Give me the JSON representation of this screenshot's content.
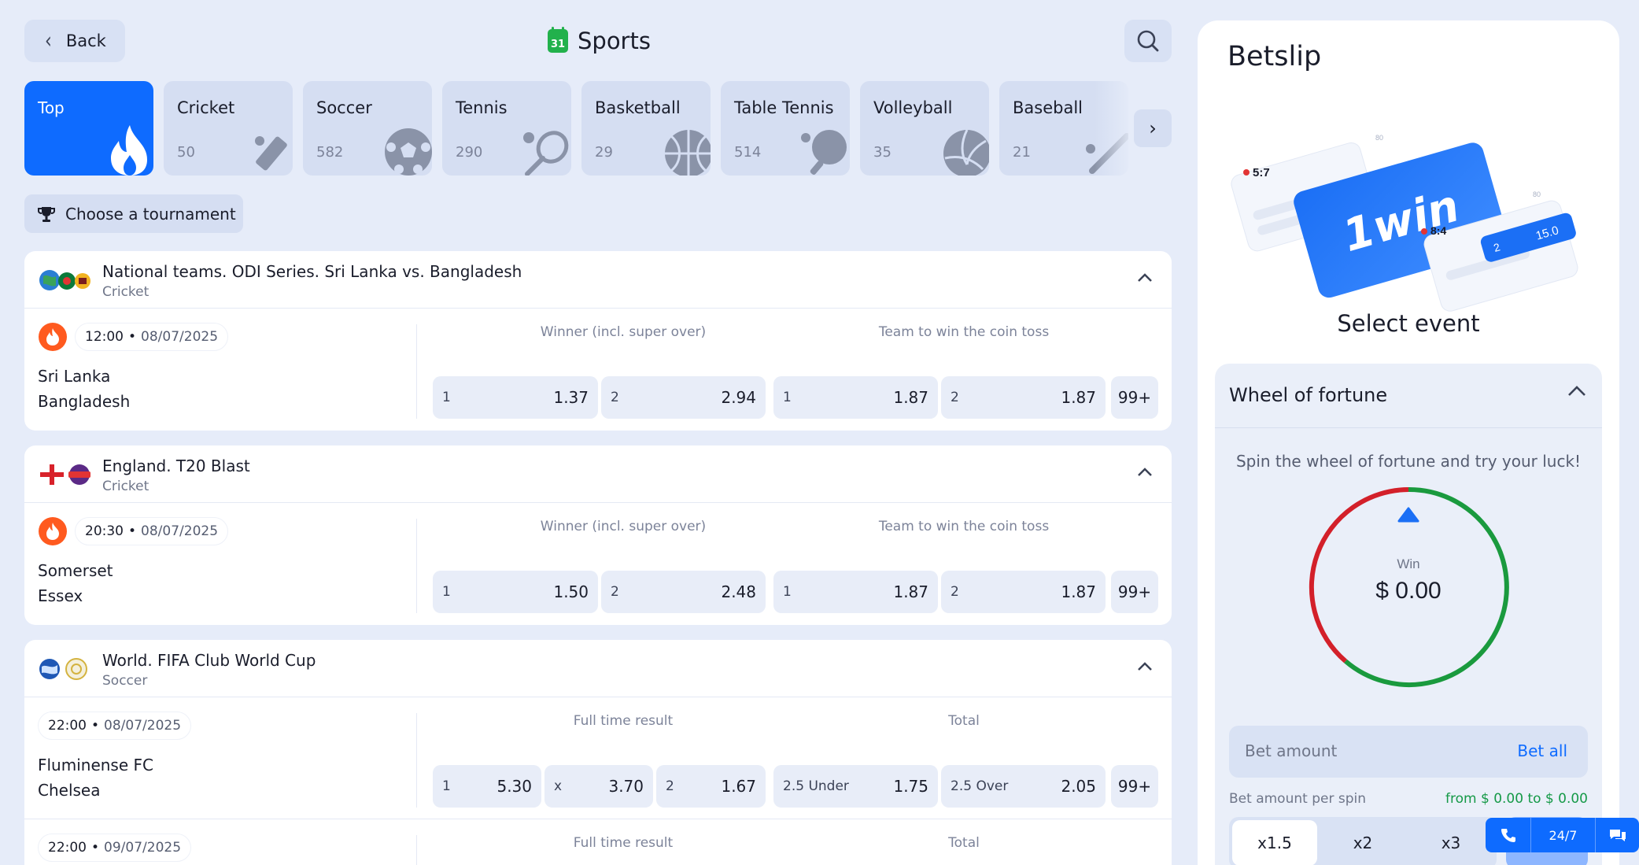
{
  "header": {
    "back_label": "Back",
    "title": "Sports",
    "calendar_day": "31"
  },
  "sports": [
    {
      "name": "Top",
      "count": ""
    },
    {
      "name": "Cricket",
      "count": "50"
    },
    {
      "name": "Soccer",
      "count": "582"
    },
    {
      "name": "Tennis",
      "count": "290"
    },
    {
      "name": "Basketball",
      "count": "29"
    },
    {
      "name": "Table Tennis",
      "count": "514"
    },
    {
      "name": "Volleyball",
      "count": "35"
    },
    {
      "name": "Baseball",
      "count": "21"
    }
  ],
  "tournament_label": "Choose a tournament",
  "events": [
    {
      "title": "National teams. ODI Series. Sri Lanka vs. Bangladesh",
      "sport": "Cricket",
      "time": "12:00",
      "date": "08/07/2025",
      "team1": "Sri Lanka",
      "team2": "Bangladesh",
      "market1": "Winner (incl. super over)",
      "market2": "Team to win the coin toss",
      "odds": [
        {
          "label": "1",
          "value": "1.37"
        },
        {
          "label": "2",
          "value": "2.94"
        },
        {
          "label": "1",
          "value": "1.87"
        },
        {
          "label": "2",
          "value": "1.87"
        }
      ],
      "more": "99+"
    },
    {
      "title": "England. T20 Blast",
      "sport": "Cricket",
      "time": "20:30",
      "date": "08/07/2025",
      "team1": "Somerset",
      "team2": "Essex",
      "market1": "Winner (incl. super over)",
      "market2": "Team to win the coin toss",
      "odds": [
        {
          "label": "1",
          "value": "1.50"
        },
        {
          "label": "2",
          "value": "2.48"
        },
        {
          "label": "1",
          "value": "1.87"
        },
        {
          "label": "2",
          "value": "1.87"
        }
      ],
      "more": "99+"
    },
    {
      "title": "World. FIFA Club World Cup",
      "sport": "Soccer",
      "time": "22:00",
      "date": "08/07/2025",
      "team1": "Fluminense FC",
      "team2": "Chelsea",
      "market1": "Full time result",
      "market2": "Total",
      "odds": [
        {
          "label": "1",
          "value": "5.30"
        },
        {
          "label": "x",
          "value": "3.70"
        },
        {
          "label": "2",
          "value": "1.67"
        },
        {
          "label": "2.5 Under",
          "value": "1.75"
        },
        {
          "label": "2.5 Over",
          "value": "2.05"
        }
      ],
      "more": "99+",
      "next": {
        "time": "22:00",
        "date": "09/07/2025",
        "market1": "Full time result",
        "market2": "Total"
      }
    }
  ],
  "betslip": {
    "title": "Betslip",
    "select_event": "Select event",
    "illus": {
      "logo": "1win",
      "score1": "5:7",
      "score2": "8:4",
      "chip_label": "2",
      "chip_value": "15.0",
      "dots": "80"
    },
    "wheel": {
      "title": "Wheel of fortune",
      "description": "Spin the wheel of fortune and try your luck!",
      "win_label": "Win",
      "win_value": "$ 0.00",
      "bet_placeholder": "Bet amount",
      "bet_all": "Bet all",
      "per_spin": "Bet amount per spin",
      "range": "from $ 0.00 to $ 0.00",
      "multipliers": [
        "x1.5",
        "x2",
        "x3"
      ]
    }
  },
  "support": {
    "label": "24/7"
  },
  "colors": {
    "accent": "#0e6bff",
    "wheel_red": "#d3202a",
    "wheel_green": "#1a9a3e",
    "fire": "#ff5a1f"
  }
}
